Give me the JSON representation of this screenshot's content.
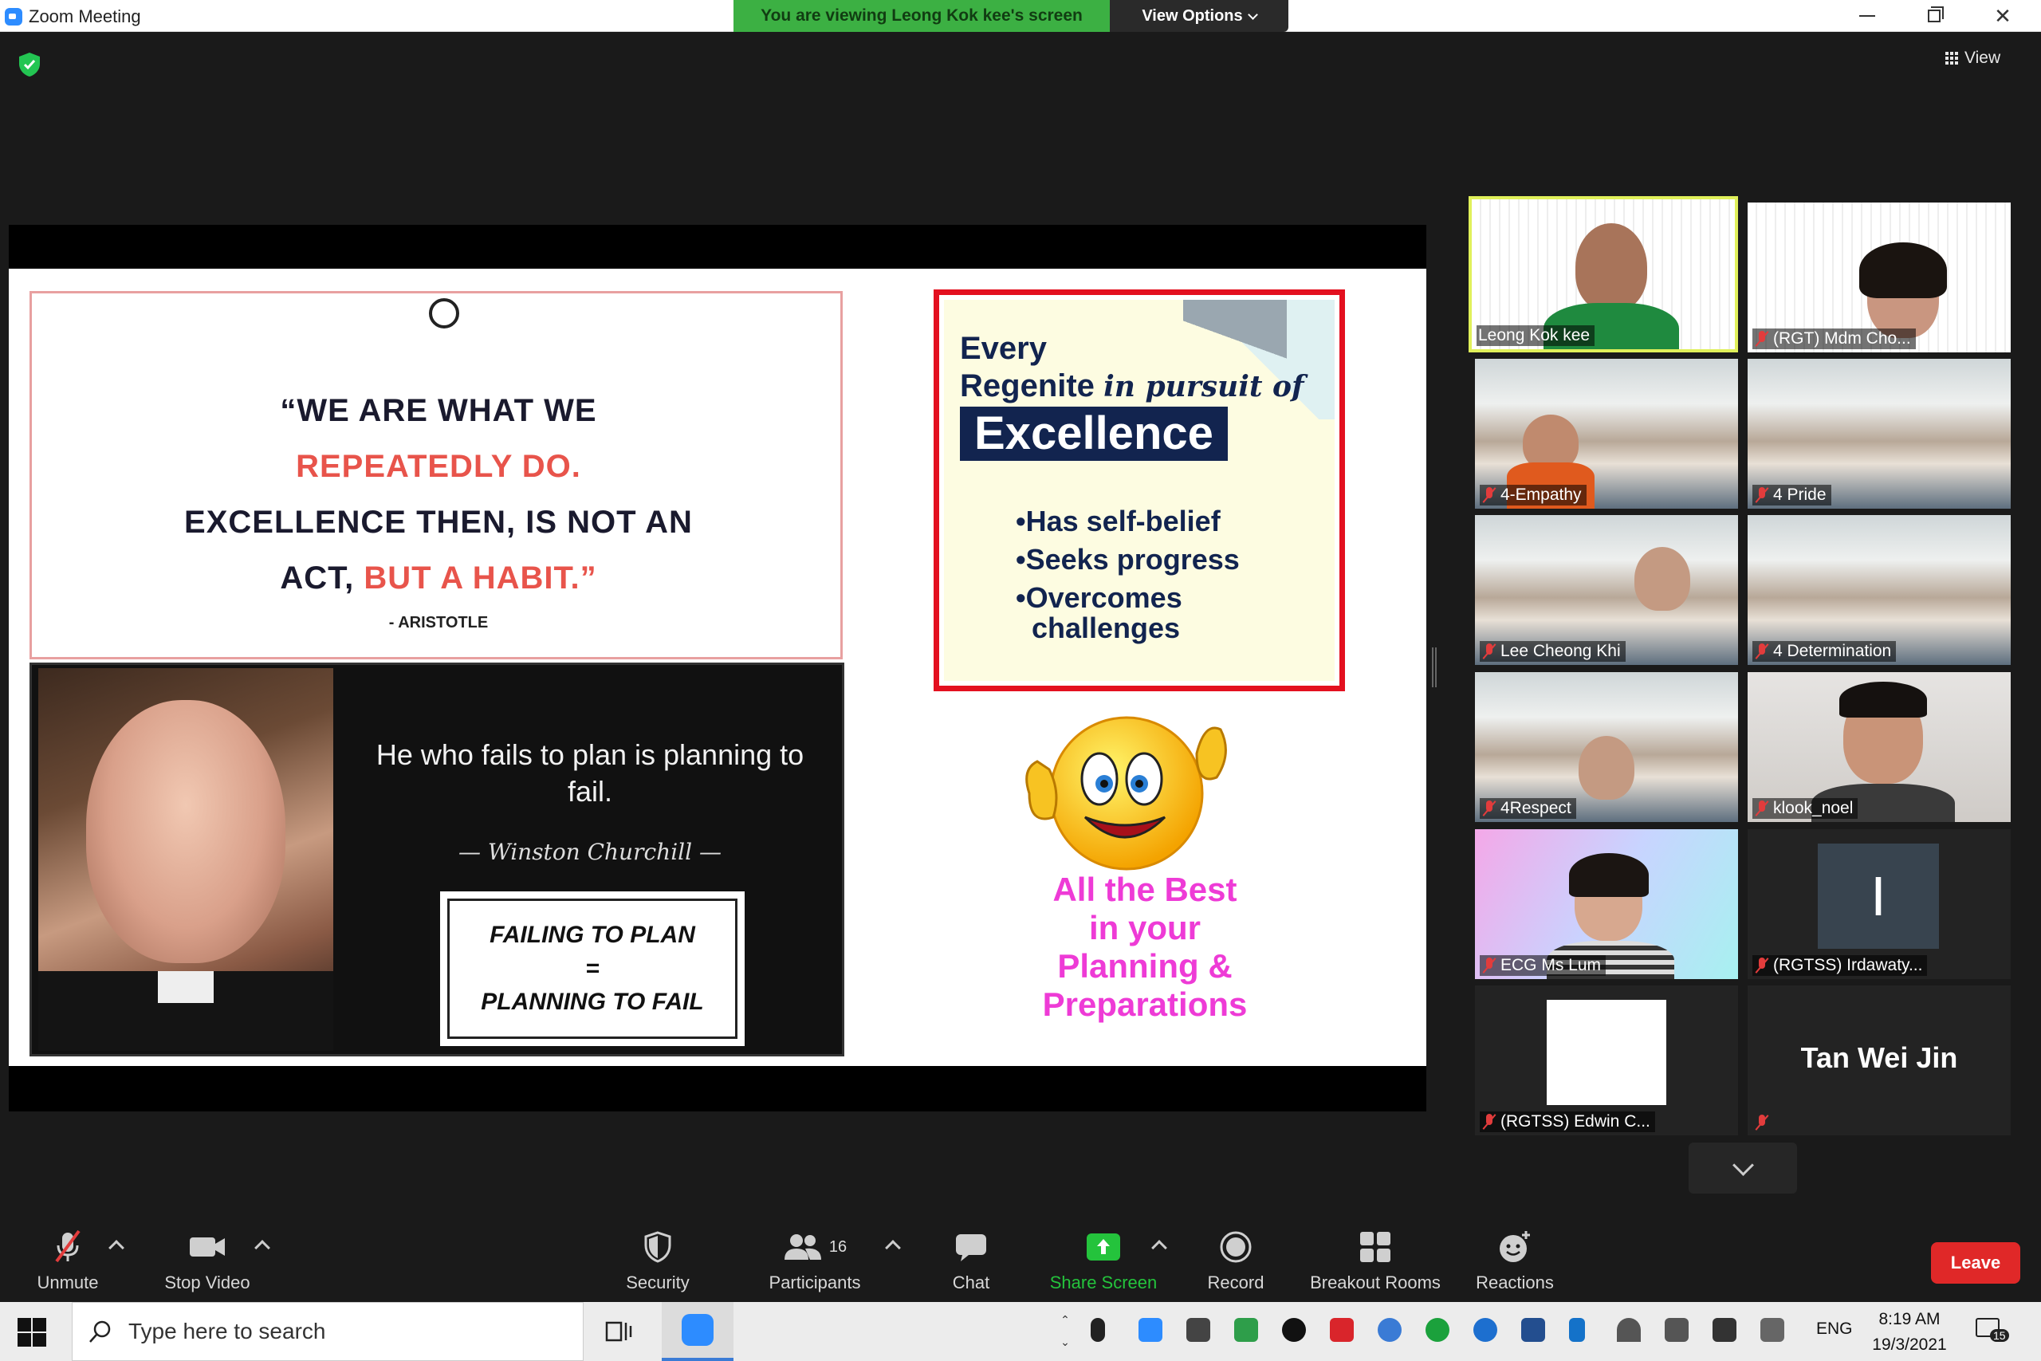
{
  "window": {
    "title": "Zoom Meeting"
  },
  "banner": {
    "viewing": "You are viewing Leong Kok kee's screen",
    "view_options": "View Options"
  },
  "view_button": "View",
  "slide": {
    "quote1": {
      "line1": "“WE ARE WHAT WE",
      "line2": "REPEATEDLY DO.",
      "line3": "EXCELLENCE THEN, IS NOT AN",
      "line4a": "ACT, ",
      "line4b": "BUT A HABIT.”",
      "author": "- ARISTOTLE"
    },
    "churchill": {
      "quote": "He who fails to plan is planning to fail.",
      "author": "— Winston Churchill —",
      "box_line1": "FAILING TO PLAN",
      "box_line2": "=",
      "box_line3": "PLANNING TO FAIL"
    },
    "excellence": {
      "every": "Every",
      "regenite": "Regenite",
      "pursuit": "in pursuit of",
      "title": "Excellence",
      "points": [
        "•Has self-belief",
        "•Seeks progress",
        "•Overcomes",
        "challenges"
      ]
    },
    "best": {
      "line1": "All the Best",
      "line2": "in your",
      "line3": "Planning &",
      "line4": "Preparations"
    }
  },
  "participants": [
    {
      "name": "Leong Kok kee",
      "muted": false,
      "active": true
    },
    {
      "name": "(RGT) Mdm Cho...",
      "muted": true
    },
    {
      "name": "4-Empathy",
      "muted": true
    },
    {
      "name": "4 Pride",
      "muted": true
    },
    {
      "name": "Lee Cheong Khi",
      "muted": true
    },
    {
      "name": "4 Determination",
      "muted": true
    },
    {
      "name": "4Respect",
      "muted": true
    },
    {
      "name": "klook_noel",
      "muted": true
    },
    {
      "name": "ECG Ms Lum",
      "muted": true
    },
    {
      "name": "(RGTSS) Irdawaty...",
      "muted": true
    },
    {
      "name": "(RGTSS) Edwin C...",
      "muted": true
    },
    {
      "name": "",
      "muted": true,
      "display_name": "Tan Wei Jin"
    }
  ],
  "tile_letters": {
    "irdawaty": "I"
  },
  "toolbar": {
    "unmute": "Unmute",
    "stop_video": "Stop Video",
    "security": "Security",
    "participants": "Participants",
    "participants_count": "16",
    "chat": "Chat",
    "share_screen": "Share Screen",
    "record": "Record",
    "breakout": "Breakout Rooms",
    "reactions": "Reactions",
    "leave": "Leave"
  },
  "taskbar": {
    "search_placeholder": "Type here to search",
    "lang": "ENG",
    "time": "8:19 AM",
    "date": "19/3/2021",
    "notif_count": "15"
  },
  "colors": {
    "banner_green": "#3cb043",
    "leave_red": "#e02828",
    "active_speaker": "#e0f05a",
    "share_green": "#24c33c"
  }
}
